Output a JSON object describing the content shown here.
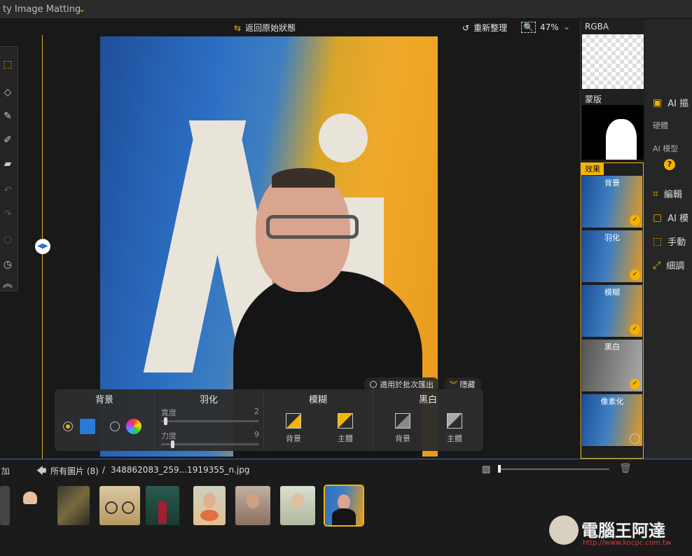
{
  "app": {
    "title": "ty Image Matting"
  },
  "toolbar": {
    "reset_label": "返回原始狀態",
    "reorganize_label": "重新整理",
    "zoom_value": "47%"
  },
  "layers": {
    "rgba_label": "RGBA",
    "mask_label": "蒙版",
    "effects_label": "效果",
    "effects": [
      {
        "label": "背景",
        "applied": true
      },
      {
        "label": "羽化",
        "applied": true
      },
      {
        "label": "模糊",
        "applied": true
      },
      {
        "label": "黑白",
        "applied": true
      },
      {
        "label": "像素化",
        "applied": false
      }
    ]
  },
  "side_tools": {
    "ai_item": "AI 摳",
    "hardness": "硬體",
    "ai_model": "AI 模型",
    "edit": "編輯",
    "ai_mode": "AI 模",
    "manual": "手動",
    "fine_tune": "細調"
  },
  "overlay": {
    "batch_label": "適用於批次匯出",
    "hide_label": "隱藏"
  },
  "effects_bar": {
    "background": {
      "title": "背景"
    },
    "feather": {
      "title": "羽化",
      "width_label": "寬度",
      "width_value": "2",
      "strength_label": "力度",
      "strength_value": "9"
    },
    "blur": {
      "title": "模糊",
      "bg_label": "背景",
      "subject_label": "主體"
    },
    "bw": {
      "title": "黑白",
      "bg_label": "背景",
      "subject_label": "主體"
    }
  },
  "gallery": {
    "add_label": "加",
    "all_images_label": "所有圖片 (8)",
    "separator": "/",
    "current_file": "348862083_259...1919355_n.jpg"
  },
  "watermark": {
    "name": "電腦王阿達",
    "url": "http://www.kocpc.com.tw"
  },
  "colors": {
    "accent": "#f5b400",
    "panel": "#2b2b2b",
    "divider": "#2e6cb8"
  }
}
